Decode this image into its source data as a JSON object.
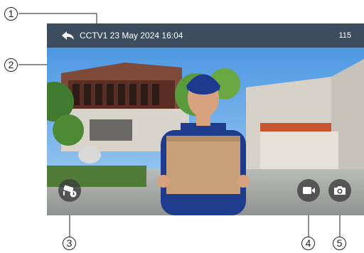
{
  "callouts": [
    "1",
    "2",
    "3",
    "4",
    "5"
  ],
  "topbar": {
    "back_icon": "back-arrow-icon",
    "title": "CCTV1 23 May 2024 16:04",
    "count": "115"
  },
  "controls": {
    "cctv": {
      "icon": "cctv-camera-icon"
    },
    "record": {
      "icon": "video-camera-icon"
    },
    "snapshot": {
      "icon": "photo-camera-icon"
    }
  },
  "colors": {
    "bar": "#3c4654",
    "sky": "#5ea6e6",
    "button": "#3c3c3c"
  }
}
